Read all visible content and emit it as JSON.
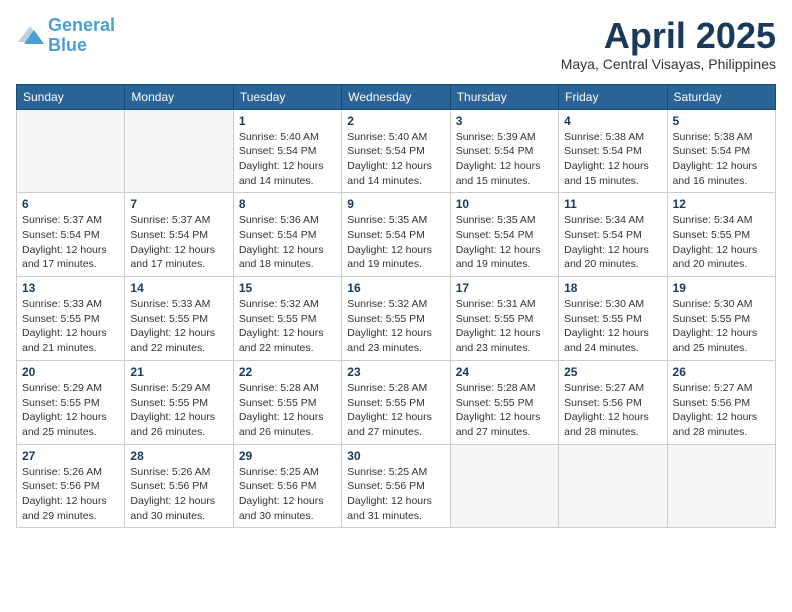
{
  "header": {
    "logo_line1": "General",
    "logo_line2": "Blue",
    "month_title": "April 2025",
    "subtitle": "Maya, Central Visayas, Philippines"
  },
  "weekdays": [
    "Sunday",
    "Monday",
    "Tuesday",
    "Wednesday",
    "Thursday",
    "Friday",
    "Saturday"
  ],
  "weeks": [
    [
      {
        "day": "",
        "info": ""
      },
      {
        "day": "",
        "info": ""
      },
      {
        "day": "1",
        "info": "Sunrise: 5:40 AM\nSunset: 5:54 PM\nDaylight: 12 hours\nand 14 minutes."
      },
      {
        "day": "2",
        "info": "Sunrise: 5:40 AM\nSunset: 5:54 PM\nDaylight: 12 hours\nand 14 minutes."
      },
      {
        "day": "3",
        "info": "Sunrise: 5:39 AM\nSunset: 5:54 PM\nDaylight: 12 hours\nand 15 minutes."
      },
      {
        "day": "4",
        "info": "Sunrise: 5:38 AM\nSunset: 5:54 PM\nDaylight: 12 hours\nand 15 minutes."
      },
      {
        "day": "5",
        "info": "Sunrise: 5:38 AM\nSunset: 5:54 PM\nDaylight: 12 hours\nand 16 minutes."
      }
    ],
    [
      {
        "day": "6",
        "info": "Sunrise: 5:37 AM\nSunset: 5:54 PM\nDaylight: 12 hours\nand 17 minutes."
      },
      {
        "day": "7",
        "info": "Sunrise: 5:37 AM\nSunset: 5:54 PM\nDaylight: 12 hours\nand 17 minutes."
      },
      {
        "day": "8",
        "info": "Sunrise: 5:36 AM\nSunset: 5:54 PM\nDaylight: 12 hours\nand 18 minutes."
      },
      {
        "day": "9",
        "info": "Sunrise: 5:35 AM\nSunset: 5:54 PM\nDaylight: 12 hours\nand 19 minutes."
      },
      {
        "day": "10",
        "info": "Sunrise: 5:35 AM\nSunset: 5:54 PM\nDaylight: 12 hours\nand 19 minutes."
      },
      {
        "day": "11",
        "info": "Sunrise: 5:34 AM\nSunset: 5:54 PM\nDaylight: 12 hours\nand 20 minutes."
      },
      {
        "day": "12",
        "info": "Sunrise: 5:34 AM\nSunset: 5:55 PM\nDaylight: 12 hours\nand 20 minutes."
      }
    ],
    [
      {
        "day": "13",
        "info": "Sunrise: 5:33 AM\nSunset: 5:55 PM\nDaylight: 12 hours\nand 21 minutes."
      },
      {
        "day": "14",
        "info": "Sunrise: 5:33 AM\nSunset: 5:55 PM\nDaylight: 12 hours\nand 22 minutes."
      },
      {
        "day": "15",
        "info": "Sunrise: 5:32 AM\nSunset: 5:55 PM\nDaylight: 12 hours\nand 22 minutes."
      },
      {
        "day": "16",
        "info": "Sunrise: 5:32 AM\nSunset: 5:55 PM\nDaylight: 12 hours\nand 23 minutes."
      },
      {
        "day": "17",
        "info": "Sunrise: 5:31 AM\nSunset: 5:55 PM\nDaylight: 12 hours\nand 23 minutes."
      },
      {
        "day": "18",
        "info": "Sunrise: 5:30 AM\nSunset: 5:55 PM\nDaylight: 12 hours\nand 24 minutes."
      },
      {
        "day": "19",
        "info": "Sunrise: 5:30 AM\nSunset: 5:55 PM\nDaylight: 12 hours\nand 25 minutes."
      }
    ],
    [
      {
        "day": "20",
        "info": "Sunrise: 5:29 AM\nSunset: 5:55 PM\nDaylight: 12 hours\nand 25 minutes."
      },
      {
        "day": "21",
        "info": "Sunrise: 5:29 AM\nSunset: 5:55 PM\nDaylight: 12 hours\nand 26 minutes."
      },
      {
        "day": "22",
        "info": "Sunrise: 5:28 AM\nSunset: 5:55 PM\nDaylight: 12 hours\nand 26 minutes."
      },
      {
        "day": "23",
        "info": "Sunrise: 5:28 AM\nSunset: 5:55 PM\nDaylight: 12 hours\nand 27 minutes."
      },
      {
        "day": "24",
        "info": "Sunrise: 5:28 AM\nSunset: 5:55 PM\nDaylight: 12 hours\nand 27 minutes."
      },
      {
        "day": "25",
        "info": "Sunrise: 5:27 AM\nSunset: 5:56 PM\nDaylight: 12 hours\nand 28 minutes."
      },
      {
        "day": "26",
        "info": "Sunrise: 5:27 AM\nSunset: 5:56 PM\nDaylight: 12 hours\nand 28 minutes."
      }
    ],
    [
      {
        "day": "27",
        "info": "Sunrise: 5:26 AM\nSunset: 5:56 PM\nDaylight: 12 hours\nand 29 minutes."
      },
      {
        "day": "28",
        "info": "Sunrise: 5:26 AM\nSunset: 5:56 PM\nDaylight: 12 hours\nand 30 minutes."
      },
      {
        "day": "29",
        "info": "Sunrise: 5:25 AM\nSunset: 5:56 PM\nDaylight: 12 hours\nand 30 minutes."
      },
      {
        "day": "30",
        "info": "Sunrise: 5:25 AM\nSunset: 5:56 PM\nDaylight: 12 hours\nand 31 minutes."
      },
      {
        "day": "",
        "info": ""
      },
      {
        "day": "",
        "info": ""
      },
      {
        "day": "",
        "info": ""
      }
    ]
  ]
}
